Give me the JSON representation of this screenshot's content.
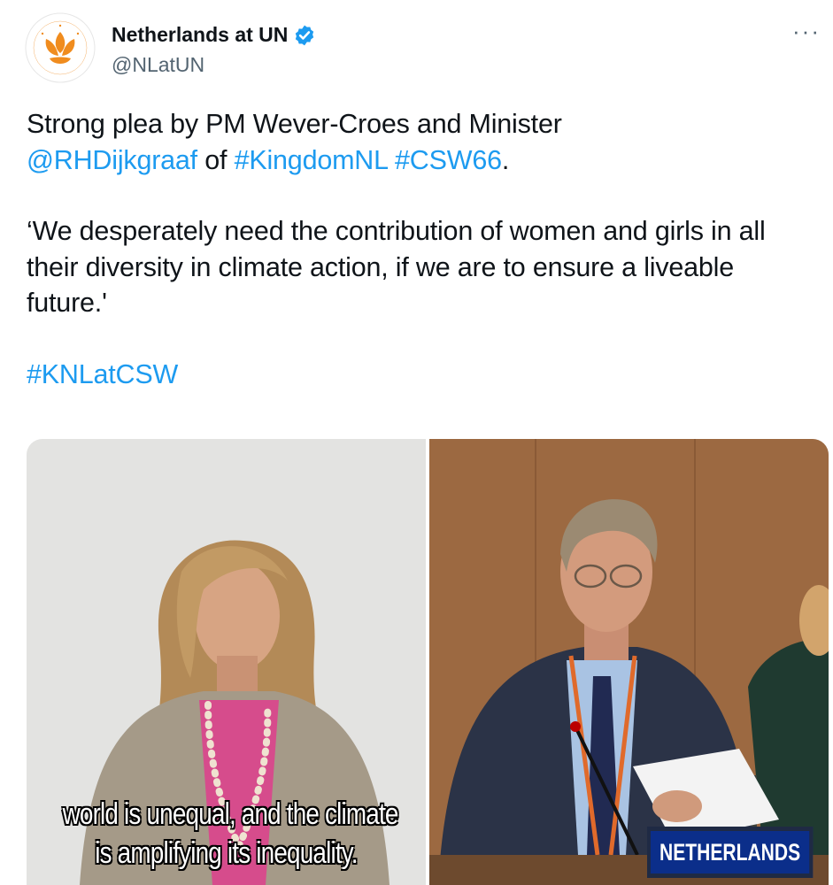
{
  "header": {
    "display_name": "Netherlands at UN",
    "handle": "@NLatUN",
    "more_label": "···"
  },
  "tweet": {
    "line1_text": "Strong plea by PM Wever-Croes and Minister",
    "mention": "@RHDijkgraaf",
    "of_text": " of ",
    "hashtag1": "#KingdomNL",
    "space": " ",
    "hashtag2": "#CSW66",
    "period": ".",
    "quote": "‘We desperately need the contribution of women and girls in all their diversity in climate action, if we are to ensure a liveable future.'",
    "hashtag3": "#KNLatCSW"
  },
  "media": {
    "photo1": {
      "caption_line1": "world is unequal, and the climate",
      "caption_line2": "is amplifying its inequality."
    },
    "photo2": {
      "nameplate": "NETHERLANDS"
    }
  },
  "colors": {
    "link": "#1d9bf0",
    "verified": "#1d9bf0",
    "logo_orange": "#f08c1e"
  }
}
